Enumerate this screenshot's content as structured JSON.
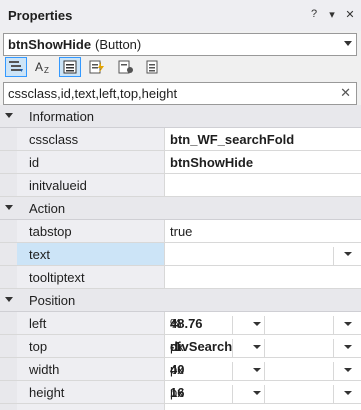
{
  "panel": {
    "title": "Properties",
    "title_icons": [
      "?",
      "▾",
      "✕"
    ]
  },
  "selector": {
    "name": "btnShowHide",
    "type": "(Button)"
  },
  "toolbar": {
    "icons": [
      "categorized-icon",
      "alphabetical-icon",
      "properties-icon",
      "events-icon",
      "property-pages-icon",
      "settings-icon"
    ]
  },
  "filter": {
    "value": "cssclass,id,text,left,top,height",
    "clear": "✕"
  },
  "categories": {
    "information": "Information",
    "action": "Action",
    "position": "Position"
  },
  "props": {
    "cssclass": {
      "name": "cssclass",
      "value": "btn_WF_searchFold"
    },
    "id": {
      "name": "id",
      "value": "btnShowHide"
    },
    "initvalueid": {
      "name": "initvalueid",
      "value": ""
    },
    "tabstop": {
      "name": "tabstop",
      "value": "true"
    },
    "text": {
      "name": "text",
      "value": ""
    },
    "tooltiptext": {
      "name": "tooltiptext",
      "value": ""
    },
    "left": {
      "name": "left",
      "value": "48.76",
      "unit": "%",
      "anchor": ""
    },
    "top": {
      "name": "top",
      "value": "-1",
      "unit": "px",
      "anchor": "divSearch"
    },
    "width": {
      "name": "width",
      "value": "40",
      "unit": "px",
      "anchor": ""
    },
    "height": {
      "name": "height",
      "value": "16",
      "unit": "px",
      "anchor": ""
    }
  }
}
